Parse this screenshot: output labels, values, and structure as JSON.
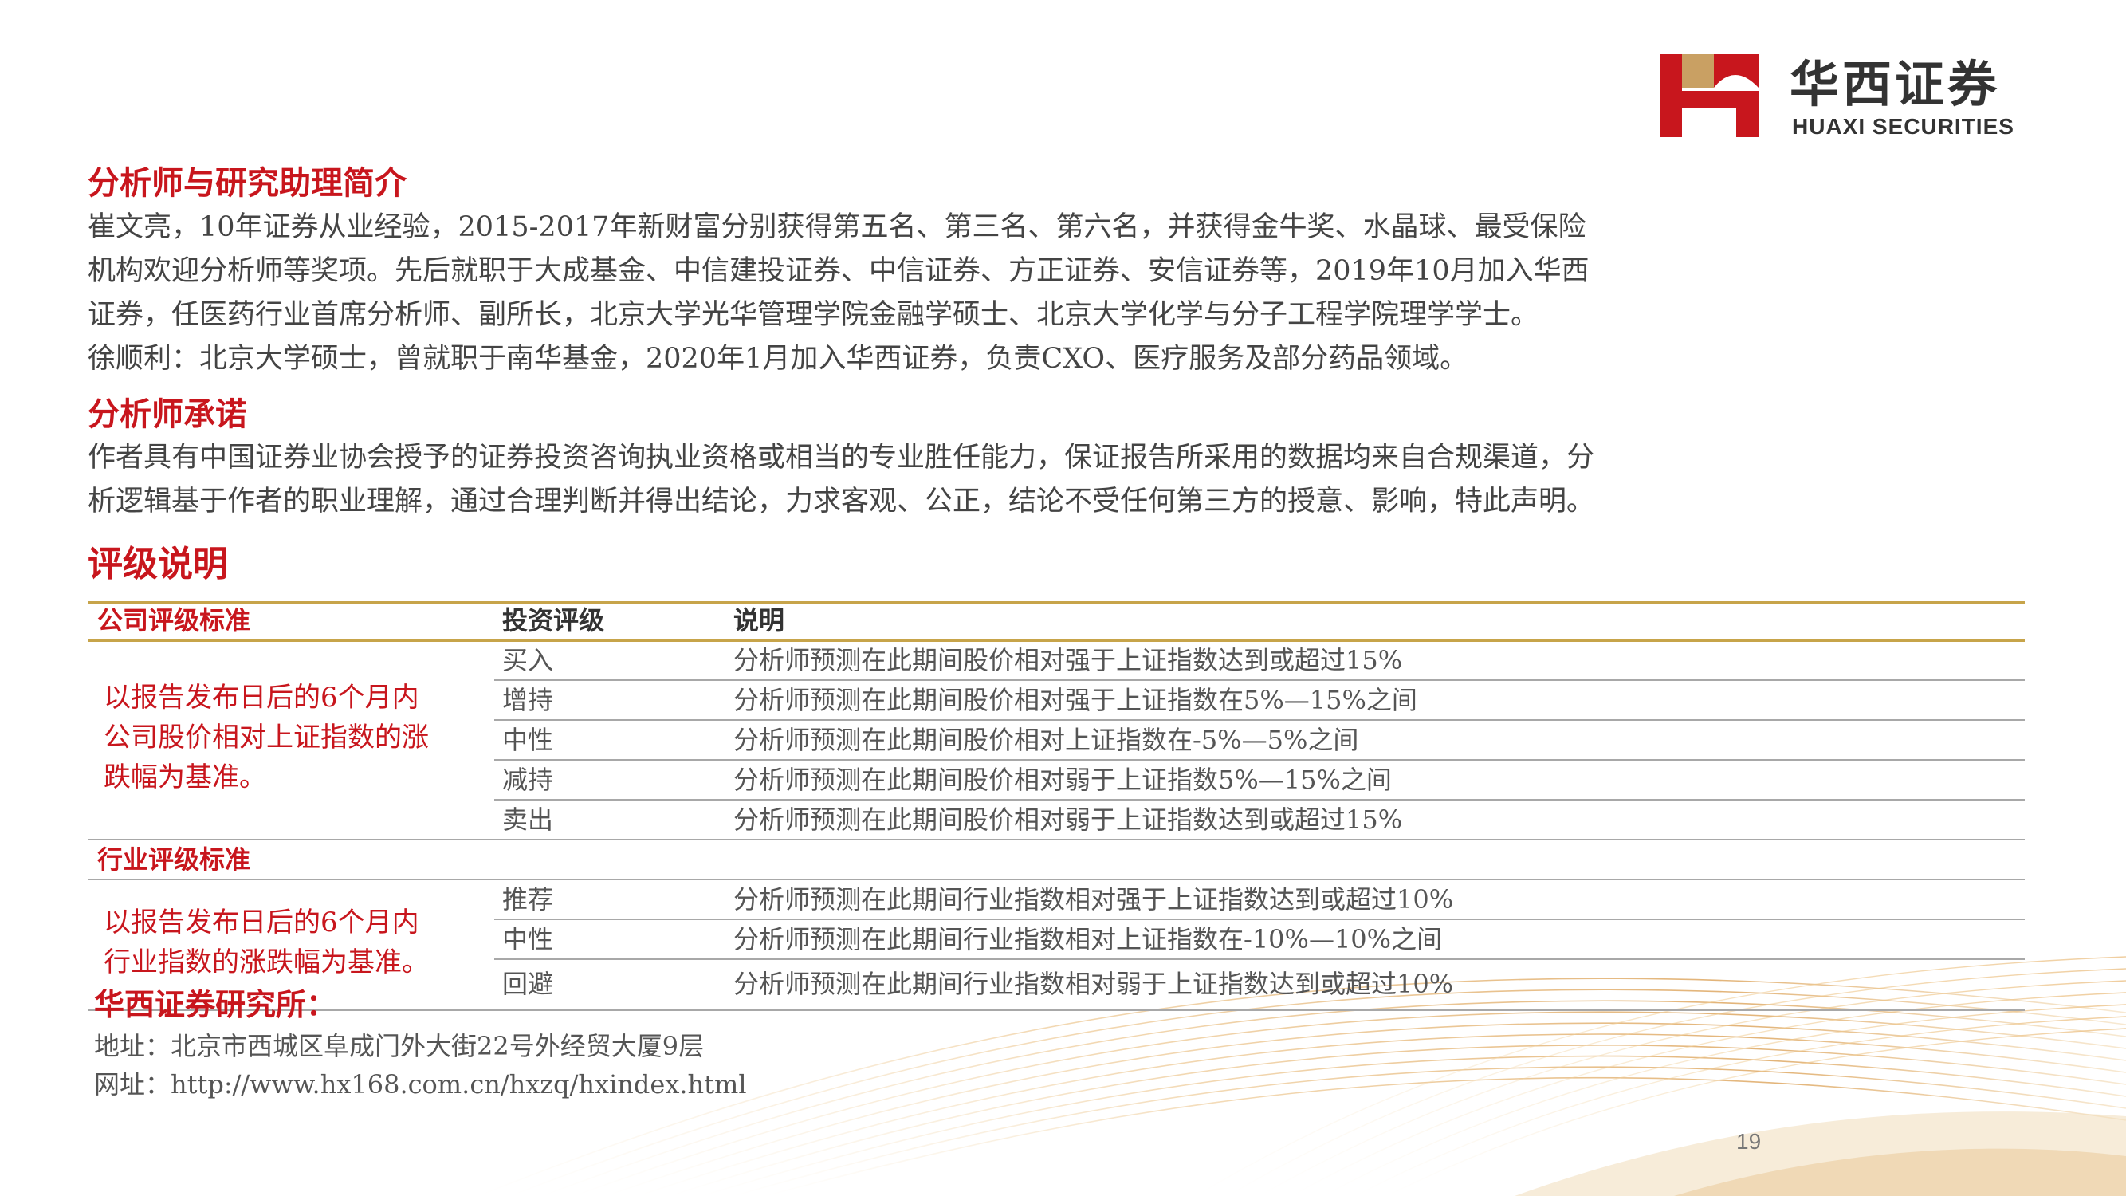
{
  "logo": {
    "cn": "华西证券",
    "en": "HUAXI SECURITIES",
    "color_red": "#c8161d",
    "color_gold": "#c9a063"
  },
  "analysts": {
    "heading": "分析师与研究助理简介",
    "lines": [
      "崔文亮，10年证券从业经验，2015-2017年新财富分别获得第五名、第三名、第六名，并获得金牛奖、水晶球、最受保险",
      "机构欢迎分析师等奖项。先后就职于大成基金、中信建投证券、中信证券、方正证券、安信证券等，2019年10月加入华西",
      "证券，任医药行业首席分析师、副所长，北京大学光华管理学院金融学硕士、北京大学化学与分子工程学院理学学士。",
      "徐顺利：北京大学硕士，曾就职于南华基金，2020年1月加入华西证券，负责CXO、医疗服务及部分药品领域。"
    ]
  },
  "commitment": {
    "heading": "分析师承诺",
    "lines": [
      "作者具有中国证券业协会授予的证券投资咨询执业资格或相当的专业胜任能力，保证报告所采用的数据均来自合规渠道，分",
      "析逻辑基于作者的职业理解，通过合理判断并得出结论，力求客观、公正，结论不受任何第三方的授意、影响，特此声明。"
    ]
  },
  "ratings": {
    "heading": "评级说明",
    "header": {
      "category": "公司评级标准",
      "rating": "投资评级",
      "desc": "说明"
    },
    "company": {
      "basis": [
        "以报告发布日后的6个月内",
        "公司股价相对上证指数的涨",
        "跌幅为基准。"
      ],
      "rows": [
        {
          "rating": "买入",
          "desc": "分析师预测在此期间股价相对强于上证指数达到或超过15%"
        },
        {
          "rating": "增持",
          "desc": "分析师预测在此期间股价相对强于上证指数在5%—15%之间"
        },
        {
          "rating": "中性",
          "desc": "分析师预测在此期间股价相对上证指数在-5%—5%之间"
        },
        {
          "rating": "减持",
          "desc": "分析师预测在此期间股价相对弱于上证指数5%—15%之间"
        },
        {
          "rating": "卖出",
          "desc": "分析师预测在此期间股价相对弱于上证指数达到或超过15%"
        }
      ]
    },
    "industry": {
      "category": "行业评级标准",
      "basis": [
        "以报告发布日后的6个月内",
        "行业指数的涨跌幅为基准。"
      ],
      "rows": [
        {
          "rating": "推荐",
          "desc": "分析师预测在此期间行业指数相对强于上证指数达到或超过10%"
        },
        {
          "rating": "中性",
          "desc": "分析师预测在此期间行业指数相对上证指数在-10%—10%之间"
        },
        {
          "rating": "回避",
          "desc": "分析师预测在此期间行业指数相对弱于上证指数达到或超过10%"
        }
      ]
    }
  },
  "institute": {
    "name": "华西证券研究所：",
    "address": "地址：北京市西城区阜成门外大街22号外经贸大厦9层",
    "website": "网址：http://www.hx168.com.cn/hxzq/hxindex.html"
  },
  "page_number": "19",
  "colors": {
    "accent_red": "#c8161d",
    "rule_gold": "#c7a44a",
    "wave_gold": "#d9a75a"
  }
}
